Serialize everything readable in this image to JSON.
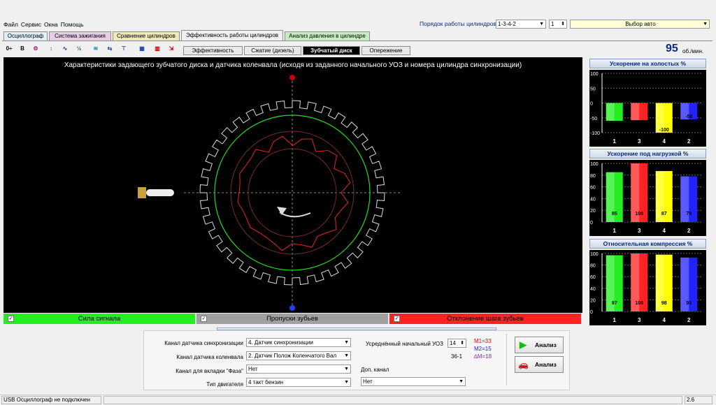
{
  "menu": [
    "Файл",
    "Сервис",
    "Окна",
    "Помощь"
  ],
  "header": {
    "order_label": "Порядок работы цилиндров",
    "order_value": "1-3-4-2",
    "cyl_value": "1",
    "auto_select": "Выбор авто"
  },
  "tabs": [
    "Осциллограф",
    "Система зажигания",
    "Сравнение цилиндров",
    "Эффективность работы цилиндров",
    "Анализ давления в цилиндре"
  ],
  "subtabs": [
    "Эффективность",
    "Сжатие (дизель)",
    "Зубчатый диск",
    "Опережение"
  ],
  "rpm": {
    "value": "95",
    "unit": "об./мин."
  },
  "scope_title": "Характеристики задающего зубчатого диска и датчика коленвала (исходя из заданного начального УОЗ и номера цилиндра синхронизации)",
  "legend": [
    "Сила сигнала",
    "Пропуски зубьев",
    "Отклонение шага зубьев"
  ],
  "panels": [
    {
      "title": "Ускорение на холостых %",
      "ticks": [
        "100",
        "50",
        "0",
        "-50",
        "-100"
      ],
      "cyl": [
        "1",
        "3",
        "4",
        "2"
      ],
      "labels": [
        "",
        "",
        "-100",
        "-50"
      ],
      "values": [
        -60,
        -58,
        -100,
        -55
      ],
      "min": -100,
      "max": 100
    },
    {
      "title": "Ускорение под нагрузкой %",
      "ticks": [
        "100",
        "80",
        "60",
        "40",
        "20",
        "0"
      ],
      "cyl": [
        "1",
        "3",
        "4",
        "2"
      ],
      "labels": [
        "85",
        "100",
        "87",
        "78"
      ],
      "values": [
        85,
        100,
        87,
        78
      ],
      "min": 0,
      "max": 100
    },
    {
      "title": "Относительная компрессия %",
      "ticks": [
        "100",
        "80",
        "60",
        "40",
        "20",
        "0"
      ],
      "cyl": [
        "1",
        "3",
        "4",
        "2"
      ],
      "labels": [
        "97",
        "100",
        "98",
        "93"
      ],
      "values": [
        97,
        100,
        98,
        93
      ],
      "min": 0,
      "max": 100
    }
  ],
  "bar_colors": [
    "#22ee22",
    "#ff2222",
    "#ffff00",
    "#2222ff"
  ],
  "form": {
    "sync_label": "Канал датчика синхронизации",
    "sync_value": "4. Датчик синхронизации",
    "crank_label": "Канал датчика коленвала",
    "crank_value": "2. Датчик Полож Коленчатого Вал",
    "phase_label": "Канал для вкладки \"Фаза\"",
    "phase_value": "Нет",
    "engine_label": "Тип двигателя",
    "engine_value": "4 такт бензин",
    "uoz_label": "Усреднённый начальный УОЗ",
    "uoz_value": "14",
    "teeth": "36-1",
    "extra_label": "Доп. канал",
    "extra_value": "Нет",
    "m1": "M1=33",
    "m2": "M2=15",
    "dm": "∆M=18",
    "btn1": "Анализ",
    "btn2": "Анализ"
  },
  "status": {
    "text": "USB Осциллограф не подключен",
    "version": "2.6"
  }
}
